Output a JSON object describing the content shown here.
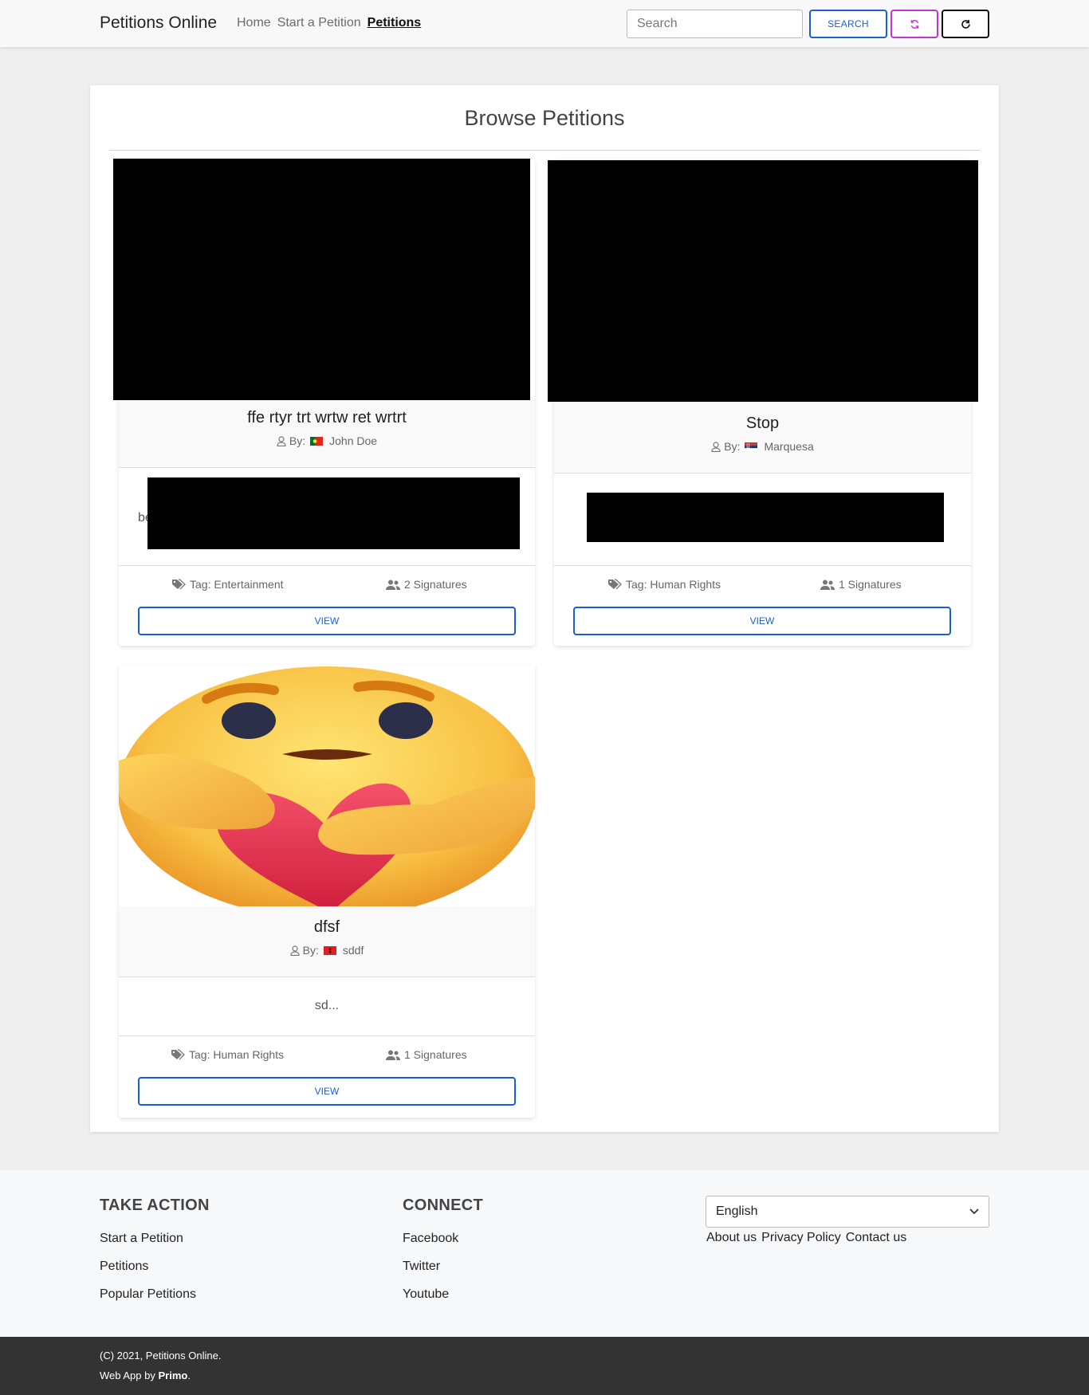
{
  "navbar": {
    "brand": "Petitions Online",
    "links": [
      "Home",
      "Start a Petition",
      "Petitions"
    ],
    "active_link": "Petitions",
    "search_placeholder": "Search",
    "search_button": "SEARCH",
    "sync_icon": "sync-icon",
    "reload_icon": "reload-icon",
    "colors": {
      "primary": "#1a5fd6",
      "sync": "#c233d8"
    }
  },
  "main": {
    "title": "Browse Petitions",
    "petitions": [
      {
        "title": "ffe rtyr trt wrtw ret wrtrt",
        "by_label": "By:",
        "author": "John Doe",
        "flag": "portugal-flag",
        "excerpt_visible": "be",
        "tag": "Tag: Entertainment",
        "signatures": "2 Signatures",
        "view_label": "VIEW"
      },
      {
        "title": "Stop",
        "by_label": "By:",
        "author": "Marquesa",
        "flag": "serbia-flag",
        "excerpt_visible": "",
        "tag": "Tag: Human Rights",
        "signatures": "1 Signatures",
        "view_label": "VIEW"
      },
      {
        "title": "dfsf",
        "by_label": "By:",
        "author": "sddf",
        "flag": "albania-flag",
        "excerpt_visible": "sd...",
        "tag": "Tag: Human Rights",
        "signatures": "1 Signatures",
        "view_label": "VIEW"
      }
    ]
  },
  "footer": {
    "take_action": {
      "heading": "TAKE ACTION",
      "links": [
        "Start a Petition",
        "Petitions",
        "Popular Petitions"
      ]
    },
    "connect": {
      "heading": "CONNECT",
      "links": [
        "Facebook",
        "Twitter",
        "Youtube"
      ]
    },
    "language": "English",
    "legal_links": [
      "About us",
      "Privacy Policy",
      "Contact us"
    ],
    "copyright": "(C) 2021, Petitions Online.",
    "credit_prefix": "Web App by ",
    "credit_name": "Primo",
    "credit_suffix": "."
  }
}
